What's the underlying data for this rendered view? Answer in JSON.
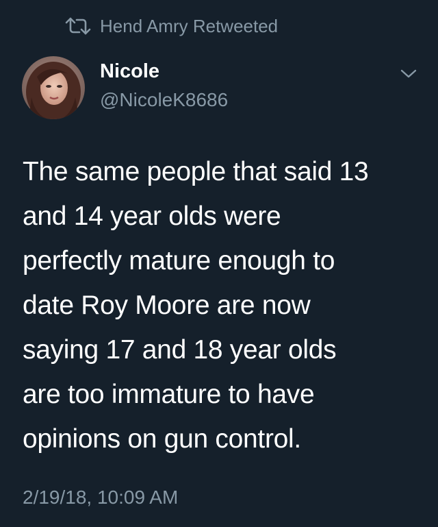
{
  "retweet": {
    "icon": "retweet-icon",
    "label": "Hend Amry Retweeted"
  },
  "author": {
    "display_name": "Nicole",
    "handle": "@NicoleK8686",
    "avatar": "avatar-photo"
  },
  "menu": {
    "icon": "chevron-down-icon"
  },
  "tweet": {
    "text": "The same people that said 13\nand 14 year olds were\nperfectly mature enough to\ndate Roy Moore are now\nsaying 17 and 18 year olds\nare too immature to have\nopinions on gun control.",
    "timestamp": "2/19/18, 10:09 AM"
  },
  "colors": {
    "background": "#15202b",
    "primary_text": "#ffffff",
    "secondary_text": "#8899a6"
  }
}
